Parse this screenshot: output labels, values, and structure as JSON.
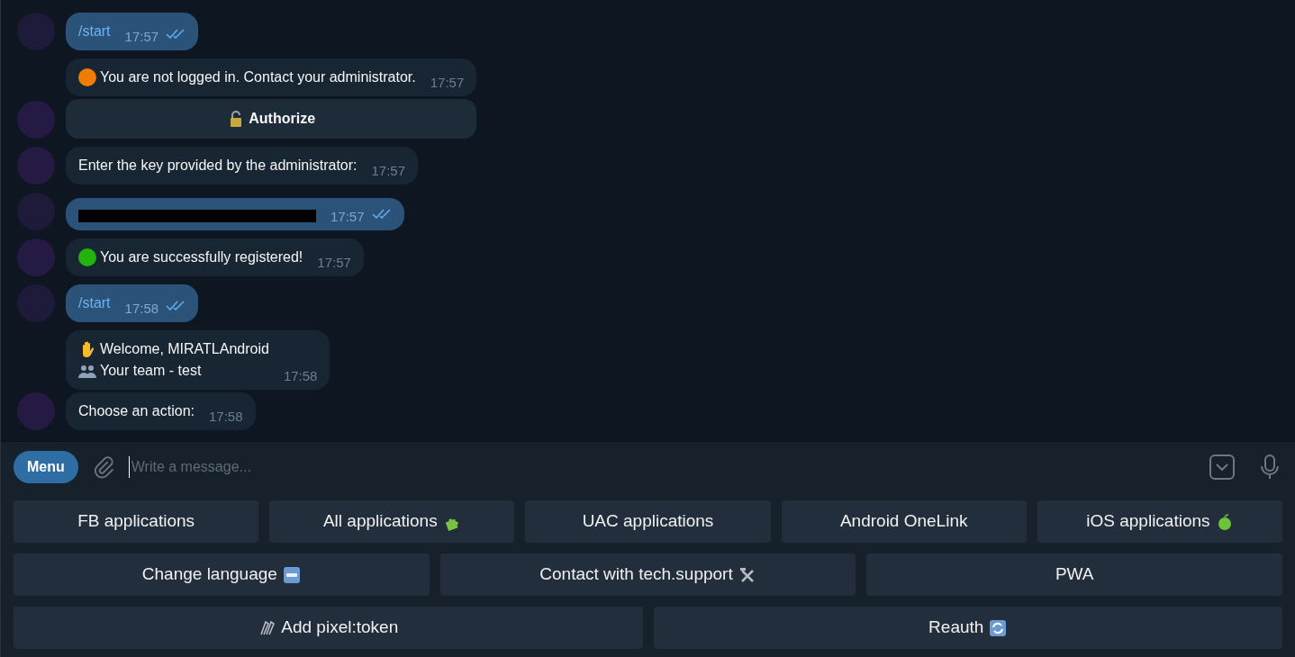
{
  "messages": [
    {
      "kind": "outgoing",
      "items": [
        {
          "kind": "command",
          "text": "/start",
          "time": "17:57",
          "read": true
        }
      ]
    },
    {
      "kind": "incoming",
      "items": [
        {
          "kind": "status",
          "color": "#f07c00",
          "text": "You are not logged in. Contact your administrator.",
          "time": "17:57",
          "inline_button": {
            "kind": "lock",
            "label": "Authorize"
          }
        }
      ]
    },
    {
      "kind": "incoming",
      "items": [
        {
          "kind": "text",
          "text": "Enter the key provided by the administrator:",
          "time": "17:57"
        }
      ]
    },
    {
      "kind": "outgoing",
      "items": [
        {
          "kind": "redacted",
          "time": "17:57",
          "read": true
        }
      ]
    },
    {
      "kind": "incoming",
      "items": [
        {
          "kind": "status",
          "color": "#22b30f",
          "text": "You are successfully registered!",
          "time": "17:57"
        }
      ]
    },
    {
      "kind": "outgoing",
      "items": [
        {
          "kind": "command",
          "text": "/start",
          "time": "17:58",
          "read": true
        }
      ]
    },
    {
      "kind": "incoming",
      "items": [
        {
          "kind": "lines",
          "lines": [
            {
              "kind": "hand",
              "text": "Welcome, MIRATLAndroid"
            },
            {
              "kind": "people",
              "text": "Your team - test"
            }
          ],
          "time": "17:58"
        },
        {
          "kind": "text",
          "text": "Choose an action:",
          "time": "17:58"
        }
      ]
    }
  ],
  "composer": {
    "menu": "Menu",
    "placeholder": "Write a message..."
  },
  "keyboard": [
    [
      {
        "kind": "plain",
        "label": "FB applications"
      },
      {
        "kind": "puzzle",
        "label": "All applications"
      },
      {
        "kind": "plain",
        "label": "UAC applications"
      },
      {
        "kind": "plain",
        "label": "Android OneLink"
      },
      {
        "kind": "apple",
        "label": "iOS applications"
      }
    ],
    [
      {
        "kind": "abc",
        "label": "Change language"
      },
      {
        "kind": "tools",
        "label": "Contact with tech.support"
      },
      {
        "kind": "plain",
        "label": "PWA"
      }
    ],
    [
      {
        "kind": "clips",
        "label": "Add pixel:token"
      },
      {
        "kind": "refresh",
        "label": "Reauth"
      }
    ]
  ]
}
